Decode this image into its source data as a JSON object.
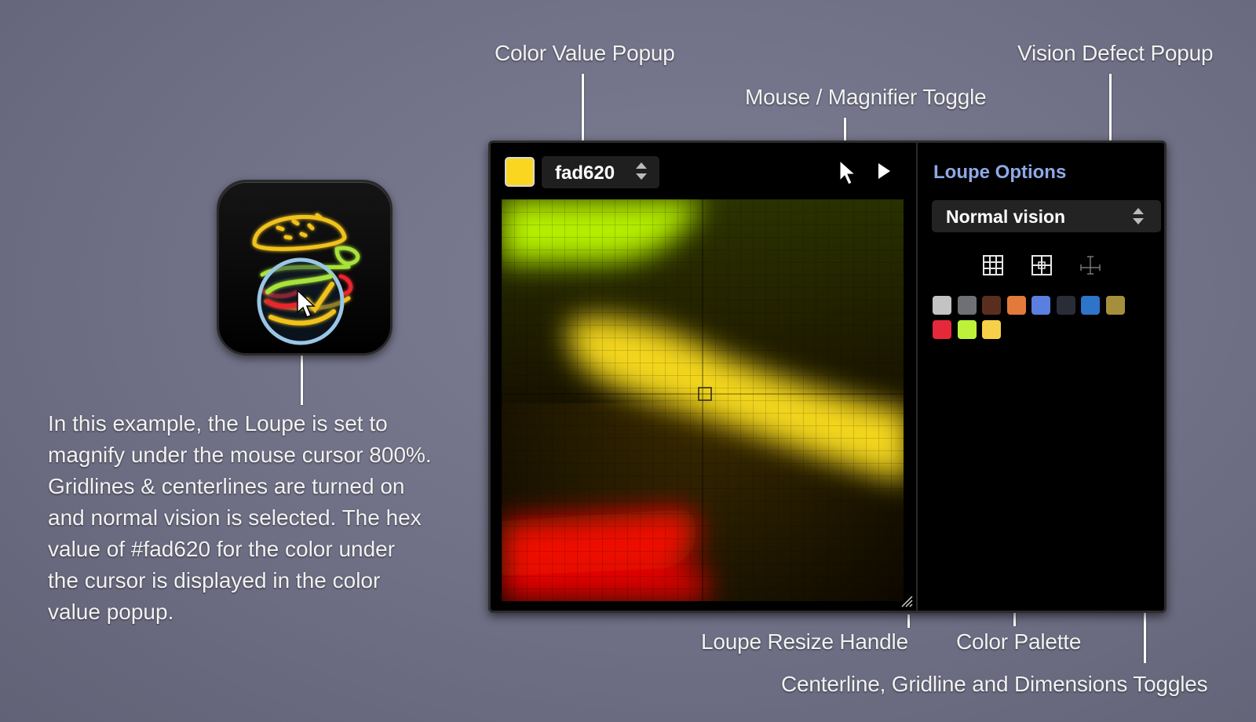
{
  "callouts": {
    "color_value_popup": "Color Value Popup",
    "mouse_magnifier_toggle": "Mouse / Magnifier Toggle",
    "vision_defect_popup": "Vision Defect Popup",
    "loupe_resize_handle": "Loupe Resize Handle",
    "color_palette": "Color Palette",
    "toggles": "Centerline, Gridline and Dimensions Toggles"
  },
  "description": [
    "In this example, the Loupe is set to",
    "magnify under the mouse cursor 800%.",
    "Gridlines & centerlines are turned on",
    "and normal vision is selected. The hex",
    "value of #fad620 for the color under",
    "the cursor is displayed in the color",
    "value popup."
  ],
  "loupe": {
    "current_color": "#fad620",
    "hex_value": "fad620",
    "options_title": "Loupe Options",
    "vision_mode": "Normal vision",
    "toggles": [
      {
        "name": "gridline-toggle-icon",
        "active": true
      },
      {
        "name": "centerline-toggle-icon",
        "active": true
      },
      {
        "name": "dimensions-toggle-icon",
        "active": false
      }
    ],
    "palette": [
      "#c3c3c3",
      "#6f6f76",
      "#5a2e1f",
      "#e27a3c",
      "#5b7fe0",
      "#2a2d38",
      "#2e74c9",
      "#a68f3c",
      "#e5283a",
      "#bdf23a",
      "#f6d048"
    ]
  }
}
